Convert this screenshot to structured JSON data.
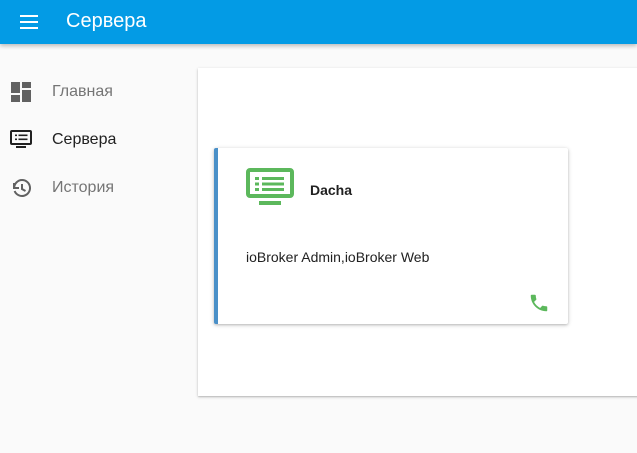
{
  "header": {
    "title": "Сервера",
    "menu_icon": "menu-icon",
    "color": "#039be5"
  },
  "sidebar": {
    "items": [
      {
        "label": "Главная",
        "icon": "dashboard-icon",
        "active": false
      },
      {
        "label": "Сервера",
        "icon": "monitor-list-icon",
        "active": true
      },
      {
        "label": "История",
        "icon": "history-icon",
        "active": false
      }
    ]
  },
  "server_card": {
    "name": "Dacha",
    "description": "ioBroker Admin,ioBroker Web",
    "icon": "server-monitor-icon",
    "action_icon": "phone-icon",
    "icon_color": "#5cb85c",
    "accent_color": "#4a90c8"
  }
}
